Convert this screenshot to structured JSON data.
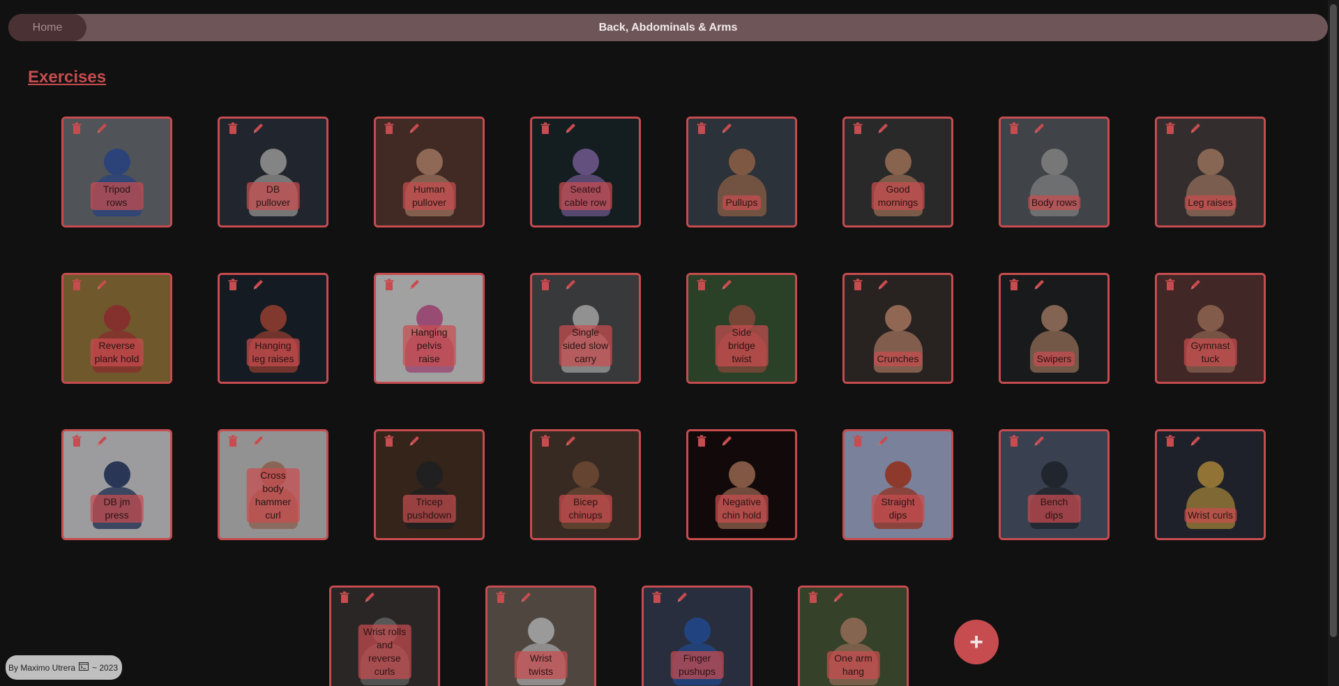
{
  "header": {
    "home_label": "Home",
    "title": "Back, Abdominals & Arms"
  },
  "section": {
    "title": "Exercises"
  },
  "exercises": [
    {
      "name": "Tripod rows",
      "bg": "#6f7479",
      "fg": "#3d5ea8"
    },
    {
      "name": "DB pullover",
      "bg": "#2f3440",
      "fg": "#b8b8b8"
    },
    {
      "name": "Human pullover",
      "bg": "#5a3a33",
      "fg": "#c69277"
    },
    {
      "name": "Seated cable row",
      "bg": "#1d2a2d",
      "fg": "#8a6fb0"
    },
    {
      "name": "Pullups",
      "bg": "#3e4650",
      "fg": "#b07b5e"
    },
    {
      "name": "Good mornings",
      "bg": "#3a3a3a",
      "fg": "#bd8a6c"
    },
    {
      "name": "Body rows",
      "bg": "#595f66",
      "fg": "#a5a5a5"
    },
    {
      "name": "Leg raises",
      "bg": "#473f40",
      "fg": "#bb8e74"
    },
    {
      "name": "Reverse plank hold",
      "bg": "#9a7b3e",
      "fg": "#b8453f"
    },
    {
      "name": "Hanging leg raises",
      "bg": "#1e2630",
      "fg": "#b35040"
    },
    {
      "name": "Hanging pelvis raise",
      "bg": "#e0e0e0",
      "fg": "#d46aa0"
    },
    {
      "name": "Single sided slow carry",
      "bg": "#4e4f52",
      "fg": "#c9c9c9"
    },
    {
      "name": "Side bridge twist",
      "bg": "#3b5a38",
      "fg": "#a7614d"
    },
    {
      "name": "Crunches",
      "bg": "#38302f",
      "fg": "#c88f74"
    },
    {
      "name": "Swipers",
      "bg": "#222426",
      "fg": "#b68a71"
    },
    {
      "name": "Gymnast tuck",
      "bg": "#5a3734",
      "fg": "#b47f68"
    },
    {
      "name": "DB jm press",
      "bg": "#d9d9dc",
      "fg": "#3b4b78"
    },
    {
      "name": "Cross body hammer curl",
      "bg": "#cbcbcb",
      "fg": "#c08c76"
    },
    {
      "name": "Tricep pushdown",
      "bg": "#4a3324",
      "fg": "#2d2d2d"
    },
    {
      "name": "Bicep chinups",
      "bg": "#4d3b30",
      "fg": "#8d5f45"
    },
    {
      "name": "Negative chin hold",
      "bg": "#1a0f0f",
      "fg": "#b57a60"
    },
    {
      "name": "Straight dips",
      "bg": "#a9b3d6",
      "fg": "#c4503e"
    },
    {
      "name": "Bench dips",
      "bg": "#4f5a6f",
      "fg": "#2e3440"
    },
    {
      "name": "Wrist curls",
      "bg": "#2a2f3a",
      "fg": "#c9a14a"
    }
  ],
  "exercises_last_row": [
    {
      "name": "Wrist rolls and reverse curls",
      "bg": "#3b3535",
      "fg": "#7b7b7b"
    },
    {
      "name": "Wrist twists",
      "bg": "#6e6258",
      "fg": "#d6d6d6"
    },
    {
      "name": "Finger pushups",
      "bg": "#3a4156",
      "fg": "#2f5fb3"
    },
    {
      "name": "One arm hang",
      "bg": "#4a5a3a",
      "fg": "#b98c70"
    }
  ],
  "add_button": {
    "label": "+"
  },
  "footer": {
    "author": "By Maximo Utrera",
    "year": "~ 2023",
    "icon": "terminal-icon"
  }
}
